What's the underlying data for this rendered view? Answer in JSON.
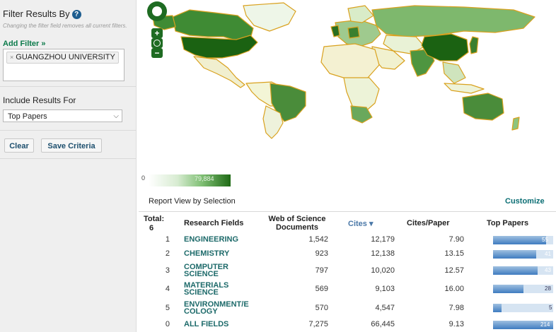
{
  "sidebar": {
    "title": "Filter Results By",
    "help_icon": "?",
    "hint": "Changing the filter field removes all current filters.",
    "add_filter": "Add Filter »",
    "filter_chip": "GUANGZHOU UNIVERSITY",
    "chip_remove": "×",
    "include_label": "Include Results For",
    "include_value": "Top Papers",
    "clear_label": "Clear",
    "save_label": "Save Criteria"
  },
  "map": {
    "legend_min": "0",
    "legend_max": "79,884",
    "colors": {
      "low": "#f2f8ec",
      "mid": "#8cc47e",
      "high": "#1f6a15",
      "border": "#d9a11e"
    }
  },
  "report": {
    "title": "Report View by Selection",
    "customize": "Customize",
    "total_label": "Total:",
    "total_value": "6",
    "columns": [
      "Research Fields",
      "Web of Science Documents",
      "Cites",
      "Cites/Paper",
      "Top Papers"
    ],
    "sort_icon": "▾",
    "rows": [
      {
        "rank": "1",
        "field": "ENGINEERING",
        "docs": "1,542",
        "cites": "12,179",
        "cpp": "7.90",
        "top": "55",
        "fill": 0.88
      },
      {
        "rank": "2",
        "field": "CHEMISTRY",
        "docs": "923",
        "cites": "12,138",
        "cpp": "13.15",
        "top": "41",
        "fill": 0.72
      },
      {
        "rank": "3",
        "field": "COMPUTER SCIENCE",
        "docs": "797",
        "cites": "10,020",
        "cpp": "12.57",
        "top": "43",
        "fill": 0.74
      },
      {
        "rank": "4",
        "field": "MATERIALS SCIENCE",
        "docs": "569",
        "cites": "9,103",
        "cpp": "16.00",
        "top": "28",
        "fill": 0.5
      },
      {
        "rank": "5",
        "field": "ENVIRONMENT/E COLOGY",
        "docs": "570",
        "cites": "4,547",
        "cpp": "7.98",
        "top": "5",
        "fill": 0.14
      },
      {
        "rank": "0",
        "field": "ALL FIELDS",
        "docs": "7,275",
        "cites": "66,445",
        "cpp": "9.13",
        "top": "214",
        "fill": 1.0
      }
    ]
  }
}
